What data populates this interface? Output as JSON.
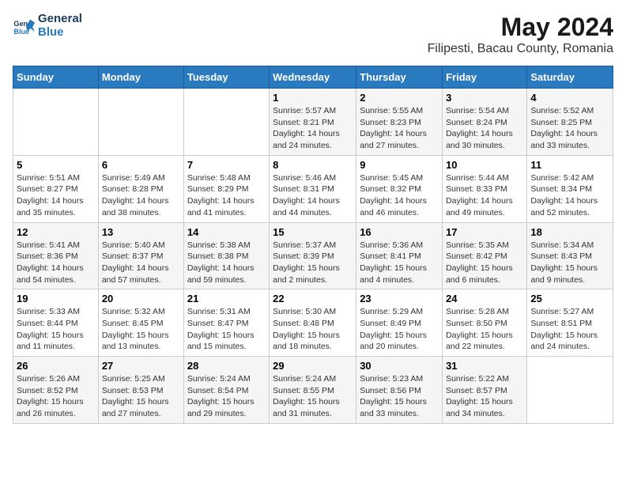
{
  "logo": {
    "line1": "General",
    "line2": "Blue"
  },
  "title": "May 2024",
  "subtitle": "Filipesti, Bacau County, Romania",
  "weekdays": [
    "Sunday",
    "Monday",
    "Tuesday",
    "Wednesday",
    "Thursday",
    "Friday",
    "Saturday"
  ],
  "weeks": [
    [
      {
        "day": "",
        "info": ""
      },
      {
        "day": "",
        "info": ""
      },
      {
        "day": "",
        "info": ""
      },
      {
        "day": "1",
        "info": "Sunrise: 5:57 AM\nSunset: 8:21 PM\nDaylight: 14 hours\nand 24 minutes."
      },
      {
        "day": "2",
        "info": "Sunrise: 5:55 AM\nSunset: 8:23 PM\nDaylight: 14 hours\nand 27 minutes."
      },
      {
        "day": "3",
        "info": "Sunrise: 5:54 AM\nSunset: 8:24 PM\nDaylight: 14 hours\nand 30 minutes."
      },
      {
        "day": "4",
        "info": "Sunrise: 5:52 AM\nSunset: 8:25 PM\nDaylight: 14 hours\nand 33 minutes."
      }
    ],
    [
      {
        "day": "5",
        "info": "Sunrise: 5:51 AM\nSunset: 8:27 PM\nDaylight: 14 hours\nand 35 minutes."
      },
      {
        "day": "6",
        "info": "Sunrise: 5:49 AM\nSunset: 8:28 PM\nDaylight: 14 hours\nand 38 minutes."
      },
      {
        "day": "7",
        "info": "Sunrise: 5:48 AM\nSunset: 8:29 PM\nDaylight: 14 hours\nand 41 minutes."
      },
      {
        "day": "8",
        "info": "Sunrise: 5:46 AM\nSunset: 8:31 PM\nDaylight: 14 hours\nand 44 minutes."
      },
      {
        "day": "9",
        "info": "Sunrise: 5:45 AM\nSunset: 8:32 PM\nDaylight: 14 hours\nand 46 minutes."
      },
      {
        "day": "10",
        "info": "Sunrise: 5:44 AM\nSunset: 8:33 PM\nDaylight: 14 hours\nand 49 minutes."
      },
      {
        "day": "11",
        "info": "Sunrise: 5:42 AM\nSunset: 8:34 PM\nDaylight: 14 hours\nand 52 minutes."
      }
    ],
    [
      {
        "day": "12",
        "info": "Sunrise: 5:41 AM\nSunset: 8:36 PM\nDaylight: 14 hours\nand 54 minutes."
      },
      {
        "day": "13",
        "info": "Sunrise: 5:40 AM\nSunset: 8:37 PM\nDaylight: 14 hours\nand 57 minutes."
      },
      {
        "day": "14",
        "info": "Sunrise: 5:38 AM\nSunset: 8:38 PM\nDaylight: 14 hours\nand 59 minutes."
      },
      {
        "day": "15",
        "info": "Sunrise: 5:37 AM\nSunset: 8:39 PM\nDaylight: 15 hours\nand 2 minutes."
      },
      {
        "day": "16",
        "info": "Sunrise: 5:36 AM\nSunset: 8:41 PM\nDaylight: 15 hours\nand 4 minutes."
      },
      {
        "day": "17",
        "info": "Sunrise: 5:35 AM\nSunset: 8:42 PM\nDaylight: 15 hours\nand 6 minutes."
      },
      {
        "day": "18",
        "info": "Sunrise: 5:34 AM\nSunset: 8:43 PM\nDaylight: 15 hours\nand 9 minutes."
      }
    ],
    [
      {
        "day": "19",
        "info": "Sunrise: 5:33 AM\nSunset: 8:44 PM\nDaylight: 15 hours\nand 11 minutes."
      },
      {
        "day": "20",
        "info": "Sunrise: 5:32 AM\nSunset: 8:45 PM\nDaylight: 15 hours\nand 13 minutes."
      },
      {
        "day": "21",
        "info": "Sunrise: 5:31 AM\nSunset: 8:47 PM\nDaylight: 15 hours\nand 15 minutes."
      },
      {
        "day": "22",
        "info": "Sunrise: 5:30 AM\nSunset: 8:48 PM\nDaylight: 15 hours\nand 18 minutes."
      },
      {
        "day": "23",
        "info": "Sunrise: 5:29 AM\nSunset: 8:49 PM\nDaylight: 15 hours\nand 20 minutes."
      },
      {
        "day": "24",
        "info": "Sunrise: 5:28 AM\nSunset: 8:50 PM\nDaylight: 15 hours\nand 22 minutes."
      },
      {
        "day": "25",
        "info": "Sunrise: 5:27 AM\nSunset: 8:51 PM\nDaylight: 15 hours\nand 24 minutes."
      }
    ],
    [
      {
        "day": "26",
        "info": "Sunrise: 5:26 AM\nSunset: 8:52 PM\nDaylight: 15 hours\nand 26 minutes."
      },
      {
        "day": "27",
        "info": "Sunrise: 5:25 AM\nSunset: 8:53 PM\nDaylight: 15 hours\nand 27 minutes."
      },
      {
        "day": "28",
        "info": "Sunrise: 5:24 AM\nSunset: 8:54 PM\nDaylight: 15 hours\nand 29 minutes."
      },
      {
        "day": "29",
        "info": "Sunrise: 5:24 AM\nSunset: 8:55 PM\nDaylight: 15 hours\nand 31 minutes."
      },
      {
        "day": "30",
        "info": "Sunrise: 5:23 AM\nSunset: 8:56 PM\nDaylight: 15 hours\nand 33 minutes."
      },
      {
        "day": "31",
        "info": "Sunrise: 5:22 AM\nSunset: 8:57 PM\nDaylight: 15 hours\nand 34 minutes."
      },
      {
        "day": "",
        "info": ""
      }
    ]
  ]
}
